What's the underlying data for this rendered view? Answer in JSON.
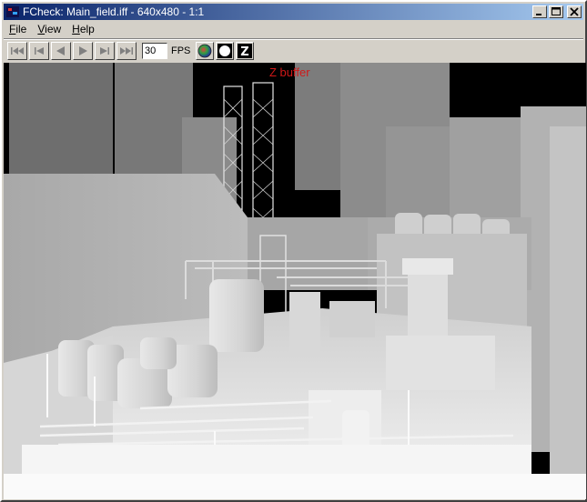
{
  "window": {
    "title": "FCheck: Main_field.iff - 640x480 - 1:1",
    "minimize_label": "_",
    "maximize_label": "□",
    "close_label": "✕"
  },
  "menu": {
    "items": [
      {
        "mnemonic": "F",
        "rest": "ile"
      },
      {
        "mnemonic": "V",
        "rest": "iew"
      },
      {
        "mnemonic": "H",
        "rest": "elp"
      }
    ]
  },
  "toolbar": {
    "buttons": [
      {
        "icon": "skip-to-start-icon"
      },
      {
        "icon": "step-back-icon"
      },
      {
        "icon": "play-reverse-icon"
      },
      {
        "icon": "play-icon"
      },
      {
        "icon": "step-forward-icon"
      },
      {
        "icon": "skip-to-end-icon"
      }
    ],
    "fps_value": "30",
    "fps_label": "FPS",
    "modes": [
      {
        "icon": "rgb-channel-icon"
      },
      {
        "icon": "alpha-channel-icon"
      },
      {
        "icon": "z-depth-icon",
        "glyph": "Z"
      }
    ]
  },
  "viewport": {
    "channel_label": "Z buffer"
  },
  "colors": {
    "title_active": "#0a246a",
    "zbuffer_label": "#d01818",
    "chrome": "#d4d0c8"
  }
}
